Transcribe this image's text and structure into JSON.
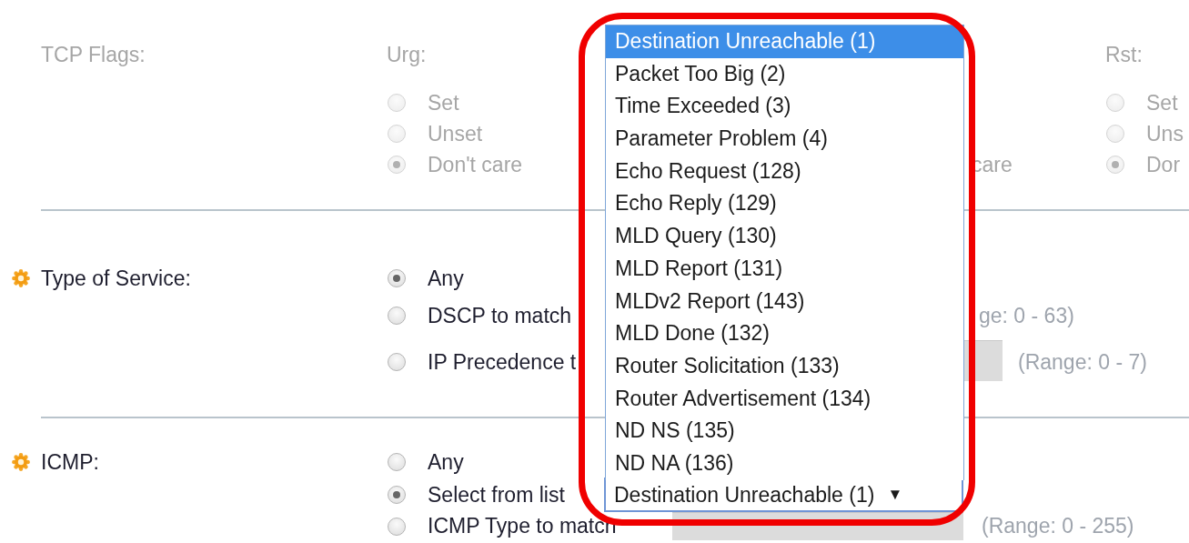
{
  "tcp_flags": {
    "label": "TCP Flags:",
    "disabled": true,
    "groups": [
      {
        "kind": "radios",
        "label": "Urg:",
        "options": [
          {
            "label": "Set",
            "selected": false
          },
          {
            "label": "Unset",
            "selected": false
          },
          {
            "label": "Don't care",
            "selected": true
          }
        ]
      },
      {
        "kind": "covered",
        "text": "care"
      },
      {
        "kind": "radios",
        "label": "Rst:",
        "options": [
          {
            "label": "Set",
            "selected": false
          },
          {
            "label": "Uns",
            "selected": false
          },
          {
            "label": "Dor",
            "selected": true
          }
        ]
      }
    ]
  },
  "type_of_service": {
    "label": "Type of Service:",
    "required": true,
    "options": [
      {
        "kind": "plain",
        "label": "Any",
        "selected": true
      },
      {
        "kind": "range",
        "label": "DSCP to match",
        "selected": false,
        "range": "ge: 0 - 63)"
      },
      {
        "kind": "field",
        "label": "IP Precedence t",
        "selected": false,
        "range": "(Range: 0 - 7)"
      }
    ]
  },
  "icmp": {
    "label": "ICMP:",
    "required": true,
    "options": [
      {
        "kind": "plain",
        "label": "Any",
        "selected": false
      },
      {
        "kind": "select",
        "label": "Select from list",
        "selected": true,
        "select": {
          "value": "Destination Unreachable (1)",
          "arrow": "▼",
          "expanded": true,
          "items": [
            {
              "label": "Destination Unreachable (1)",
              "selected": true
            },
            {
              "label": "Packet Too Big (2)",
              "selected": false
            },
            {
              "label": "Time Exceeded (3)",
              "selected": false
            },
            {
              "label": "Parameter Problem (4)",
              "selected": false
            },
            {
              "label": "Echo Request (128)",
              "selected": false
            },
            {
              "label": "Echo Reply (129)",
              "selected": false
            },
            {
              "label": "MLD Query (130)",
              "selected": false
            },
            {
              "label": "MLD Report (131)",
              "selected": false
            },
            {
              "label": "MLDv2 Report (143)",
              "selected": false
            },
            {
              "label": "MLD Done (132)",
              "selected": false
            },
            {
              "label": "Router Solicitation (133)",
              "selected": false
            },
            {
              "label": "Router Advertisement (134)",
              "selected": false
            },
            {
              "label": "ND NS (135)",
              "selected": false
            },
            {
              "label": "ND NA (136)",
              "selected": false
            }
          ]
        }
      },
      {
        "kind": "field",
        "label": "ICMP Type to match",
        "selected": false,
        "range": "(Range: 0 - 255)"
      }
    ]
  },
  "annotation": {
    "kind": "ring"
  }
}
